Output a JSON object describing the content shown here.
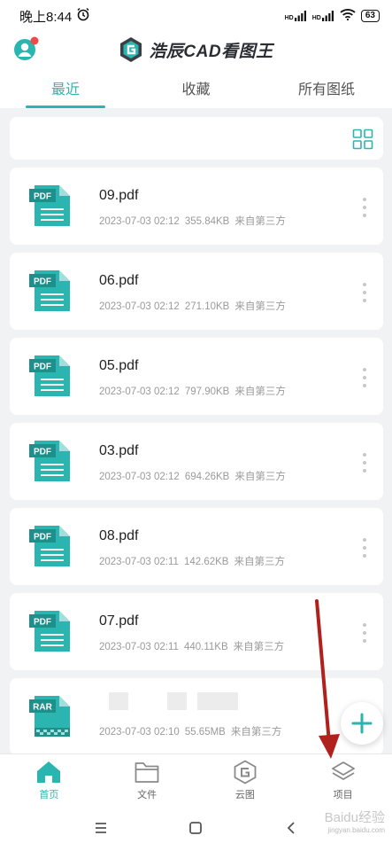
{
  "status_bar": {
    "time": "晚上8:44",
    "signal_label_1": "HD",
    "signal_label_2": "HD",
    "battery": "63"
  },
  "header": {
    "app_title": "浩辰CAD看图王"
  },
  "tabs": [
    {
      "label": "最近",
      "active": true
    },
    {
      "label": "收藏",
      "active": false
    },
    {
      "label": "所有图纸",
      "active": false
    }
  ],
  "files": [
    {
      "name": "09.pdf",
      "date": "2023-07-03 02:12",
      "size": "355.84KB",
      "source": "来自第三方",
      "type": "PDF"
    },
    {
      "name": "06.pdf",
      "date": "2023-07-03 02:12",
      "size": "271.10KB",
      "source": "来自第三方",
      "type": "PDF"
    },
    {
      "name": "05.pdf",
      "date": "2023-07-03 02:12",
      "size": "797.90KB",
      "source": "来自第三方",
      "type": "PDF"
    },
    {
      "name": "03.pdf",
      "date": "2023-07-03 02:12",
      "size": "694.26KB",
      "source": "来自第三方",
      "type": "PDF"
    },
    {
      "name": "08.pdf",
      "date": "2023-07-03 02:11",
      "size": "142.62KB",
      "source": "来自第三方",
      "type": "PDF"
    },
    {
      "name": "07.pdf",
      "date": "2023-07-03 02:11",
      "size": "440.11KB",
      "source": "来自第三方",
      "type": "PDF"
    },
    {
      "name": "",
      "date": "2023-07-03 02:10",
      "size": "55.65MB",
      "source": "来自第三方",
      "type": "RAR"
    }
  ],
  "bottom_nav": [
    {
      "label": "首页",
      "icon": "home-icon",
      "active": true
    },
    {
      "label": "文件",
      "icon": "folder-icon",
      "active": false
    },
    {
      "label": "云图",
      "icon": "cloud-drawing-icon",
      "active": false
    },
    {
      "label": "项目",
      "icon": "layers-icon",
      "active": false
    }
  ],
  "colors": {
    "accent": "#2bb5b0",
    "annotation_arrow": "#b0201c",
    "background": "#f1f2f4"
  },
  "watermark": {
    "brand": "Baidu经验",
    "url": "jingyan.baidu.com"
  }
}
